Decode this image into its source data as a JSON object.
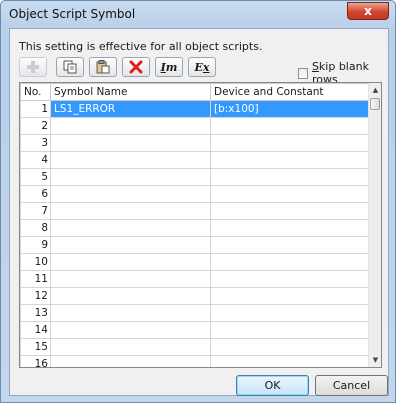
{
  "window": {
    "title": "Object Script Symbol",
    "close_glyph": "x"
  },
  "info_text": "This setting is effective for all object scripts.",
  "toolbar": {
    "buttons": [
      {
        "icon": "add-icon",
        "enabled": false
      },
      {
        "icon": "copy-icon",
        "enabled": true
      },
      {
        "icon": "paste-icon",
        "enabled": true
      },
      {
        "icon": "delete-icon",
        "enabled": true
      },
      {
        "icon": "import-icon",
        "label_letter": "I",
        "label_sub": "m",
        "enabled": true
      },
      {
        "icon": "export-icon",
        "label_letter": "E",
        "label_sub": "x",
        "enabled": true
      }
    ]
  },
  "skip_blank_rows": {
    "label_prefix": "S",
    "label_rest": "kip blank rows",
    "checked": false
  },
  "table": {
    "headers": [
      "No.",
      "Symbol Name",
      "Device and Constant"
    ],
    "rows": [
      {
        "no": "1",
        "symbol": "LS1_ERROR",
        "device": "[b:x100]"
      },
      {
        "no": "2",
        "symbol": "",
        "device": ""
      },
      {
        "no": "3",
        "symbol": "",
        "device": ""
      },
      {
        "no": "4",
        "symbol": "",
        "device": ""
      },
      {
        "no": "5",
        "symbol": "",
        "device": ""
      },
      {
        "no": "6",
        "symbol": "",
        "device": ""
      },
      {
        "no": "7",
        "symbol": "",
        "device": ""
      },
      {
        "no": "8",
        "symbol": "",
        "device": ""
      },
      {
        "no": "9",
        "symbol": "",
        "device": ""
      },
      {
        "no": "10",
        "symbol": "",
        "device": ""
      },
      {
        "no": "11",
        "symbol": "",
        "device": ""
      },
      {
        "no": "12",
        "symbol": "",
        "device": ""
      },
      {
        "no": "13",
        "symbol": "",
        "device": ""
      },
      {
        "no": "14",
        "symbol": "",
        "device": ""
      },
      {
        "no": "15",
        "symbol": "",
        "device": ""
      },
      {
        "no": "16",
        "symbol": "",
        "device": ""
      }
    ],
    "selected_row": "1"
  },
  "buttons": {
    "ok": "OK",
    "cancel": "Cancel"
  },
  "colors": {
    "selection": "#3399ff",
    "title_gradient": "#c9dbef",
    "close_red": "#d0472d"
  }
}
